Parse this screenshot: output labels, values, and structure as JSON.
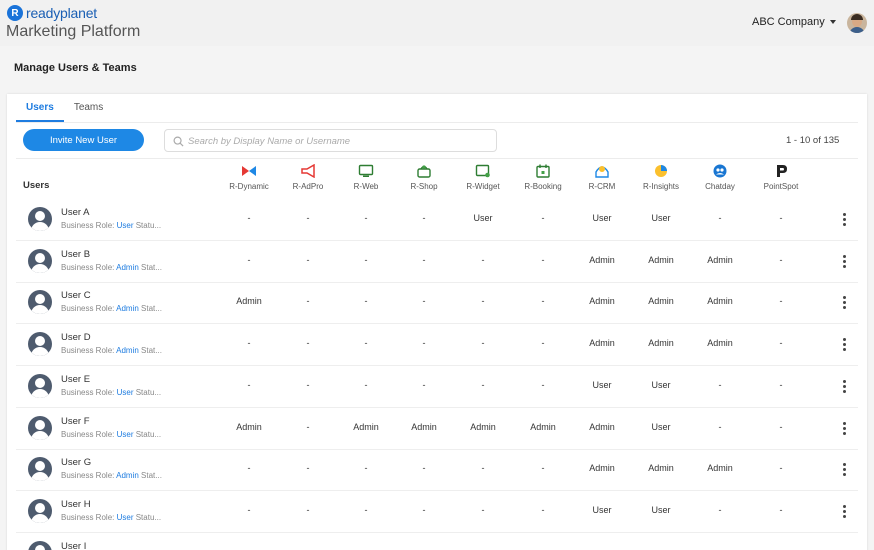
{
  "brand": {
    "logo_mark": "R",
    "logo_text": "readyplanet",
    "platform": "Marketing Platform"
  },
  "account": {
    "company": "ABC Company"
  },
  "page": {
    "title": "Manage Users & Teams"
  },
  "tabs": [
    {
      "label": "Users",
      "active": true
    },
    {
      "label": "Teams",
      "active": false
    }
  ],
  "toolbar": {
    "invite_label": "Invite New User",
    "search_placeholder": "Search by Display Name or Username",
    "search_value": "",
    "pagination": "1 - 10 of 135"
  },
  "table": {
    "users_header": "Users",
    "apps": [
      {
        "label": "R-Dynamic",
        "icon": "bowtie-icon",
        "color": "#e53935"
      },
      {
        "label": "R-AdPro",
        "icon": "megaphone-icon",
        "color": "#e53935"
      },
      {
        "label": "R-Web",
        "icon": "monitor-icon",
        "color": "#2e7d32"
      },
      {
        "label": "R-Shop",
        "icon": "bag-icon",
        "color": "#2e7d32"
      },
      {
        "label": "R-Widget",
        "icon": "widget-icon",
        "color": "#2e7d32"
      },
      {
        "label": "R-Booking",
        "icon": "calendar-icon",
        "color": "#2e7d32"
      },
      {
        "label": "R-CRM",
        "icon": "crm-icon",
        "color": "#fbc02d"
      },
      {
        "label": "R-Insights",
        "icon": "pie-icon",
        "color": "#fbc02d"
      },
      {
        "label": "Chatday",
        "icon": "chat-icon",
        "color": "#1976d2"
      },
      {
        "label": "PointSpot",
        "icon": "pointspot-icon",
        "color": "#222222"
      }
    ],
    "role_prefix": "Business Role: ",
    "rows": [
      {
        "name": "User A",
        "role": "User",
        "status": " Statu...",
        "cells": [
          "-",
          "-",
          "-",
          "-",
          "User",
          "-",
          "User",
          "User",
          "-",
          "-"
        ]
      },
      {
        "name": "User B",
        "role": "Admin",
        "status": " Stat...",
        "cells": [
          "-",
          "-",
          "-",
          "-",
          "-",
          "-",
          "Admin",
          "Admin",
          "Admin",
          "-"
        ]
      },
      {
        "name": "User C",
        "role": "Admin",
        "status": " Stat...",
        "cells": [
          "Admin",
          "-",
          "-",
          "-",
          "-",
          "-",
          "Admin",
          "Admin",
          "Admin",
          "-"
        ]
      },
      {
        "name": "User D",
        "role": "Admin",
        "status": " Stat...",
        "cells": [
          "-",
          "-",
          "-",
          "-",
          "-",
          "-",
          "Admin",
          "Admin",
          "Admin",
          "-"
        ]
      },
      {
        "name": "User E",
        "role": "User",
        "status": " Statu...",
        "cells": [
          "-",
          "-",
          "-",
          "-",
          "-",
          "-",
          "User",
          "User",
          "-",
          "-"
        ]
      },
      {
        "name": "User F",
        "role": "User",
        "status": " Statu...",
        "cells": [
          "Admin",
          "-",
          "Admin",
          "Admin",
          "Admin",
          "Admin",
          "Admin",
          "User",
          "-",
          "-"
        ]
      },
      {
        "name": "User G",
        "role": "Admin",
        "status": " Stat...",
        "cells": [
          "-",
          "-",
          "-",
          "-",
          "-",
          "-",
          "Admin",
          "Admin",
          "Admin",
          "-"
        ]
      },
      {
        "name": "User H",
        "role": "User",
        "status": " Statu...",
        "cells": [
          "-",
          "-",
          "-",
          "-",
          "-",
          "-",
          "User",
          "User",
          "-",
          "-"
        ]
      },
      {
        "name": "User I",
        "role": "",
        "status": "",
        "cells": [
          "",
          "",
          "",
          "",
          "",
          "",
          "",
          "",
          "",
          ""
        ]
      }
    ]
  }
}
